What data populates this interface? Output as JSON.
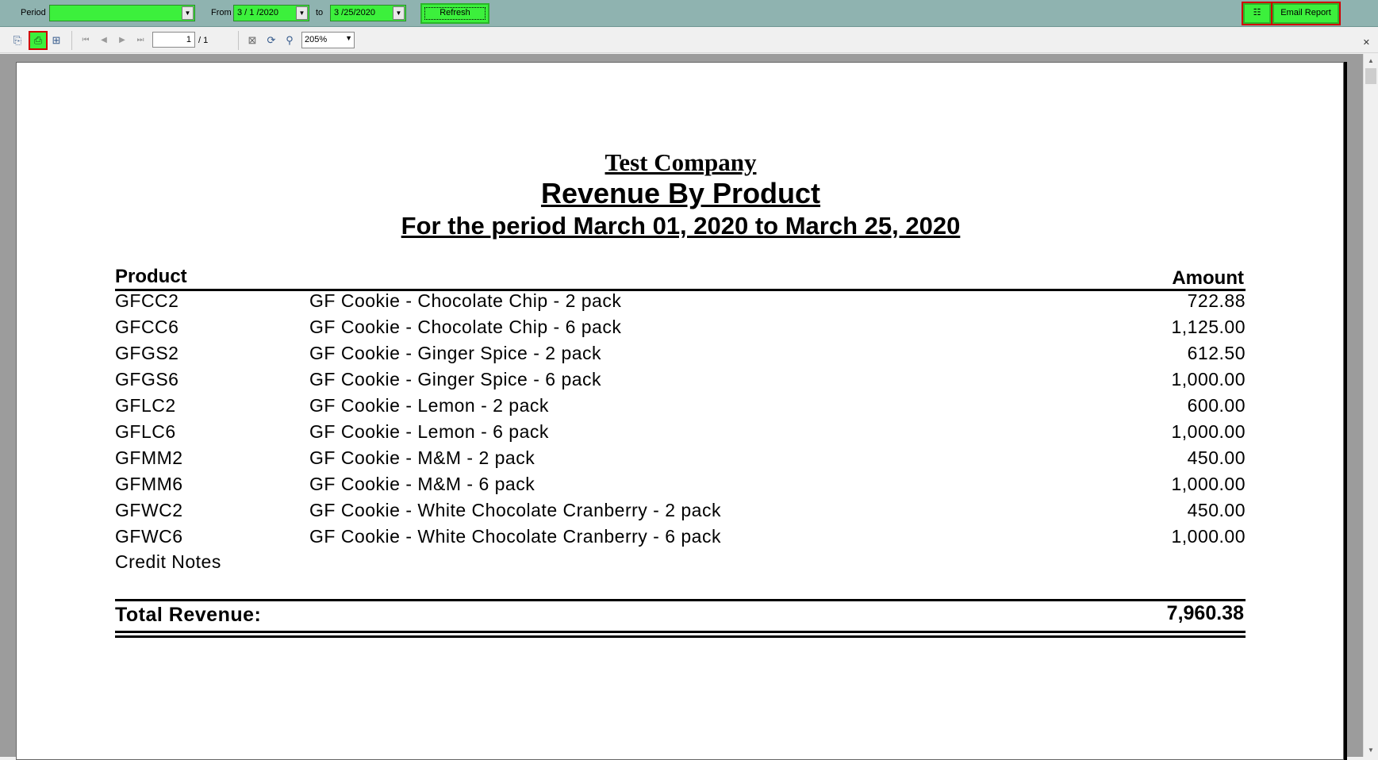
{
  "filters": {
    "period_label": "Period",
    "period_value": "",
    "from_label": "From",
    "from_value": "3 / 1 /2020",
    "to_label": "to",
    "to_value": "3 /25/2020",
    "refresh_label": "Refresh",
    "email_label": "Email Report"
  },
  "toolbar": {
    "page_current": "1",
    "page_total": "/ 1",
    "zoom": "205%"
  },
  "report": {
    "company": "Test Company",
    "title": "Revenue By Product",
    "period": "For the period March 01, 2020 to March 25, 2020",
    "col_product": "Product",
    "col_amount": "Amount",
    "rows": [
      {
        "code": "GFCC2",
        "desc": "GF Cookie - Chocolate Chip - 2 pack",
        "amount": "722.88"
      },
      {
        "code": "GFCC6",
        "desc": "GF Cookie - Chocolate Chip - 6 pack",
        "amount": "1,125.00"
      },
      {
        "code": "GFGS2",
        "desc": "GF Cookie - Ginger Spice - 2 pack",
        "amount": "612.50"
      },
      {
        "code": "GFGS6",
        "desc": "GF Cookie - Ginger Spice - 6 pack",
        "amount": "1,000.00"
      },
      {
        "code": "GFLC2",
        "desc": "GF Cookie - Lemon - 2 pack",
        "amount": "600.00"
      },
      {
        "code": "GFLC6",
        "desc": "GF Cookie - Lemon - 6 pack",
        "amount": "1,000.00"
      },
      {
        "code": "GFMM2",
        "desc": "GF Cookie - M&M - 2 pack",
        "amount": "450.00"
      },
      {
        "code": "GFMM6",
        "desc": "GF Cookie - M&M - 6 pack",
        "amount": "1,000.00"
      },
      {
        "code": "GFWC2",
        "desc": "GF Cookie - White Chocolate Cranberry - 2 pack",
        "amount": "450.00"
      },
      {
        "code": "GFWC6",
        "desc": "GF Cookie - White Chocolate Cranberry - 6 pack",
        "amount": "1,000.00"
      }
    ],
    "credit_notes": "Credit Notes",
    "total_label": "Total Revenue:",
    "total_amount": "7,960.38"
  },
  "icons": [
    "export-icon",
    "print-icon",
    "group-tree-icon",
    "first-page-icon",
    "prev-page-icon",
    "next-page-icon",
    "last-page-icon",
    "stop-icon",
    "refresh-icon",
    "search-icon",
    "list-icon",
    "close-icon"
  ],
  "colors": {
    "filter_bar": "#8fb3b0",
    "highlight_green": "#3cf03c",
    "highlight_red": "#d00000"
  }
}
